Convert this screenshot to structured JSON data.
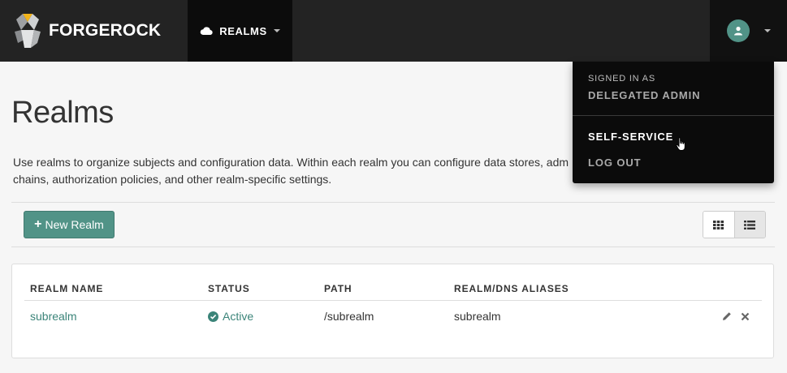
{
  "header": {
    "brand": "FORGEROCK",
    "realms_menu_label": "REALMS"
  },
  "user_dropdown": {
    "signed_in_label": "SIGNED IN AS",
    "username": "DELEGATED ADMIN",
    "items": [
      "SELF-SERVICE",
      "LOG OUT"
    ]
  },
  "page": {
    "title": "Realms",
    "description_line1": "Use realms to organize subjects and configuration data. Within each realm you can configure data stores, adm",
    "description_line2": "chains, authorization policies, and other realm-specific settings.",
    "new_button_label": "New Realm"
  },
  "table": {
    "columns": [
      "REALM NAME",
      "STATUS",
      "PATH",
      "REALM/DNS ALIASES"
    ],
    "rows": [
      {
        "name": "subrealm",
        "status": "Active",
        "path": "/subrealm",
        "aliases": "subrealm"
      }
    ]
  },
  "icons": {
    "realms": "cloud-icon",
    "user": "user-icon",
    "grid_view": "grid-icon",
    "list_view": "list-icon",
    "edit": "pencil-icon",
    "delete": "close-icon",
    "status": "check-circle-icon"
  },
  "colors": {
    "accent": "#519387",
    "link": "#3b8479",
    "navbar": "#232323"
  }
}
